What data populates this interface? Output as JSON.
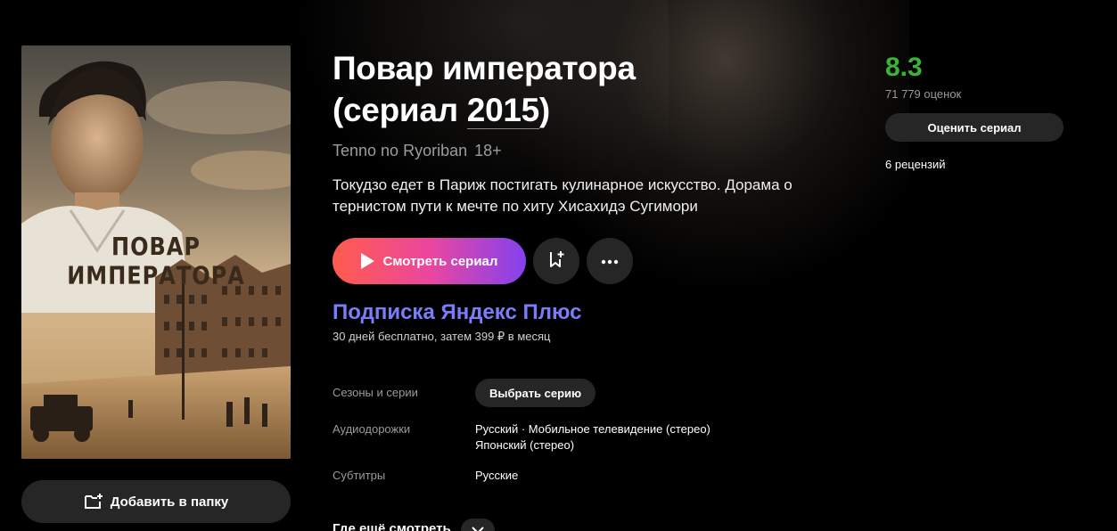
{
  "poster": {
    "title_text": "ПОВАР ИМПЕРАТОРА",
    "add_to_folder": "Добавить в папку"
  },
  "film": {
    "title_line1": "Повар императора",
    "title_line2_prefix": "(сериал ",
    "year": "2015",
    "title_line2_suffix": ")",
    "original_title": "Tenno no Ryoriban",
    "age_rating": "18+",
    "description": "Токудзо едет в Париж постигать кулинарное искусство. Дорама о тернистом пути к мечте по хиту Хисахидэ Сугимори"
  },
  "actions": {
    "watch": "Смотреть сериал",
    "bookmark_icon": "bookmark-plus-icon",
    "more_icon": "more-dots-icon"
  },
  "subscription": {
    "title": "Подписка Яндекс Плюс",
    "subtitle": "30 дней бесплатно, затем 399 ₽ в месяц"
  },
  "details": {
    "seasons_label": "Сезоны и серии",
    "choose_episode": "Выбрать серию",
    "audio_label": "Аудиодорожки",
    "audio_line1": "Русский · Мобильное телевидение (стерео)",
    "audio_line2": "Японский (стерео)",
    "subtitles_label": "Субтитры",
    "subtitles_value": "Русские",
    "where_to_watch": "Где ещё смотреть"
  },
  "rating": {
    "value": "8.3",
    "count": "71 779 оценок",
    "rate_button": "Оценить сериал",
    "reviews": "6 рецензий"
  },
  "colors": {
    "background": "#000000",
    "rating_green": "#3bb33b",
    "plus_purple": "#7b7cf7",
    "watch_gradient_start": "#ff5c4d",
    "watch_gradient_end": "#8341ef",
    "button_gray": "#262626"
  }
}
